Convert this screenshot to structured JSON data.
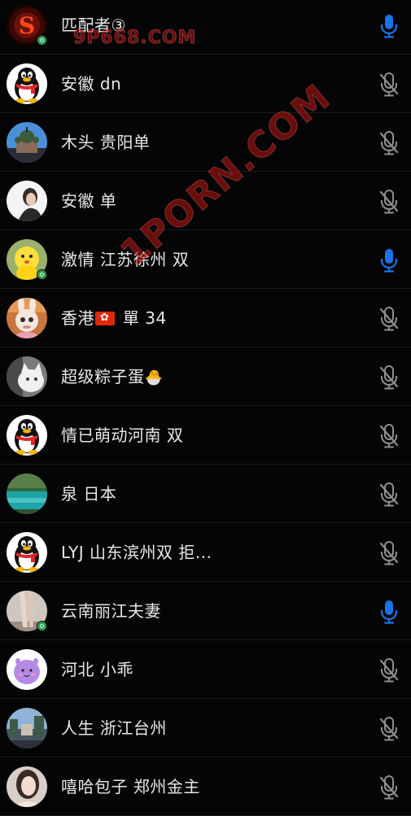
{
  "watermarks": [
    "9P668.COM",
    "1PORN.COM"
  ],
  "colors": {
    "background": "#000000",
    "mic_active": "#1a73e8",
    "mic_muted": "#8e8e8e",
    "badge": "#2f9e52"
  },
  "members": [
    {
      "name": "匹配者③",
      "mic": "active",
      "badge": true,
      "avatar": "red-s-logo"
    },
    {
      "name": "安徽  dn",
      "mic": "muted",
      "badge": false,
      "avatar": "qq-penguin"
    },
    {
      "name": "木头  贵阳单",
      "mic": "muted",
      "badge": false,
      "avatar": "cathedral-photo"
    },
    {
      "name": "安徽 单",
      "mic": "muted",
      "badge": false,
      "avatar": "person-photo"
    },
    {
      "name": "激情 江苏徐州 双",
      "mic": "active",
      "badge": true,
      "avatar": "yellow-doll"
    },
    {
      "name_prefix": "香港",
      "name_suffix": " 單 34",
      "mic": "muted",
      "badge": false,
      "avatar": "bunny-toy",
      "icon": "hong-kong-flag-icon"
    },
    {
      "name": "超级粽子蛋",
      "mic": "muted",
      "badge": false,
      "avatar": "cat-photo",
      "icon": "hatching-chick-icon"
    },
    {
      "name": "情已萌动河南 双",
      "mic": "muted",
      "badge": false,
      "avatar": "qq-penguin"
    },
    {
      "name": "泉 日本",
      "mic": "muted",
      "badge": false,
      "avatar": "lake-photo"
    },
    {
      "name": "LYJ  山东滨州双 拒...",
      "mic": "muted",
      "badge": false,
      "avatar": "qq-penguin"
    },
    {
      "name": "云南丽江夫妻",
      "mic": "active",
      "badge": true,
      "avatar": "legs-photo"
    },
    {
      "name": "河北 小乖",
      "mic": "muted",
      "badge": false,
      "avatar": "purple-creature"
    },
    {
      "name": "人生 浙江台州",
      "mic": "muted",
      "badge": false,
      "avatar": "street-photo"
    },
    {
      "name": "嘻哈包子  郑州金主",
      "mic": "muted",
      "badge": false,
      "avatar": "girl-photo"
    }
  ]
}
